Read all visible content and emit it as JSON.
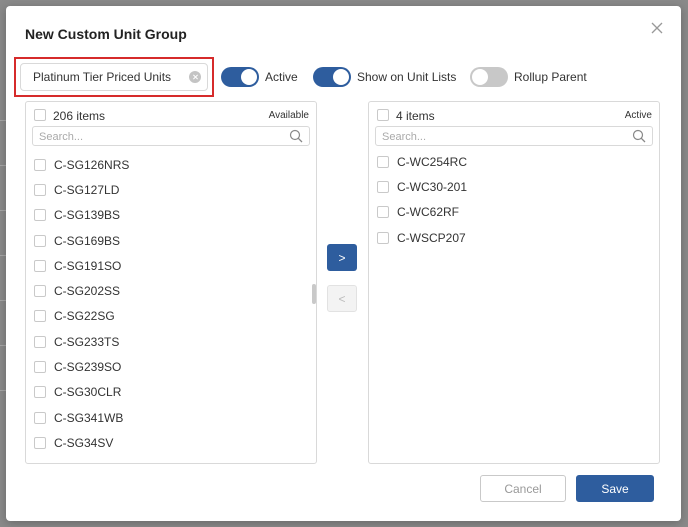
{
  "dialog": {
    "title": "New Custom Unit Group",
    "name_value": "Platinum Tier Priced Units"
  },
  "toggles": {
    "active": {
      "label": "Active",
      "on": true
    },
    "show_on_unit_lists": {
      "label": "Show on Unit Lists",
      "on": true
    },
    "rollup_parent": {
      "label": "Rollup Parent",
      "on": false
    }
  },
  "available": {
    "count_label": "206 items",
    "header_label": "Available",
    "search_placeholder": "Search...",
    "items": [
      "C-SG126NRS",
      "C-SG127LD",
      "C-SG139BS",
      "C-SG169BS",
      "C-SG191SO",
      "C-SG202SS",
      "C-SG22SG",
      "C-SG233TS",
      "C-SG239SO",
      "C-SG30CLR",
      "C-SG341WB",
      "C-SG34SV"
    ]
  },
  "active": {
    "count_label": "4 items",
    "header_label": "Active",
    "search_placeholder": "Search...",
    "items": [
      "C-WC254RC",
      "C-WC30-201",
      "C-WC62RF",
      "C-WSCP207"
    ]
  },
  "transfer": {
    "move_right_label": ">",
    "move_left_label": "<"
  },
  "footer": {
    "cancel_label": "Cancel",
    "save_label": "Save"
  },
  "colors": {
    "accent": "#2e5d9e",
    "highlight": "#d62b2b",
    "toggle_off": "#c8c8c8"
  }
}
